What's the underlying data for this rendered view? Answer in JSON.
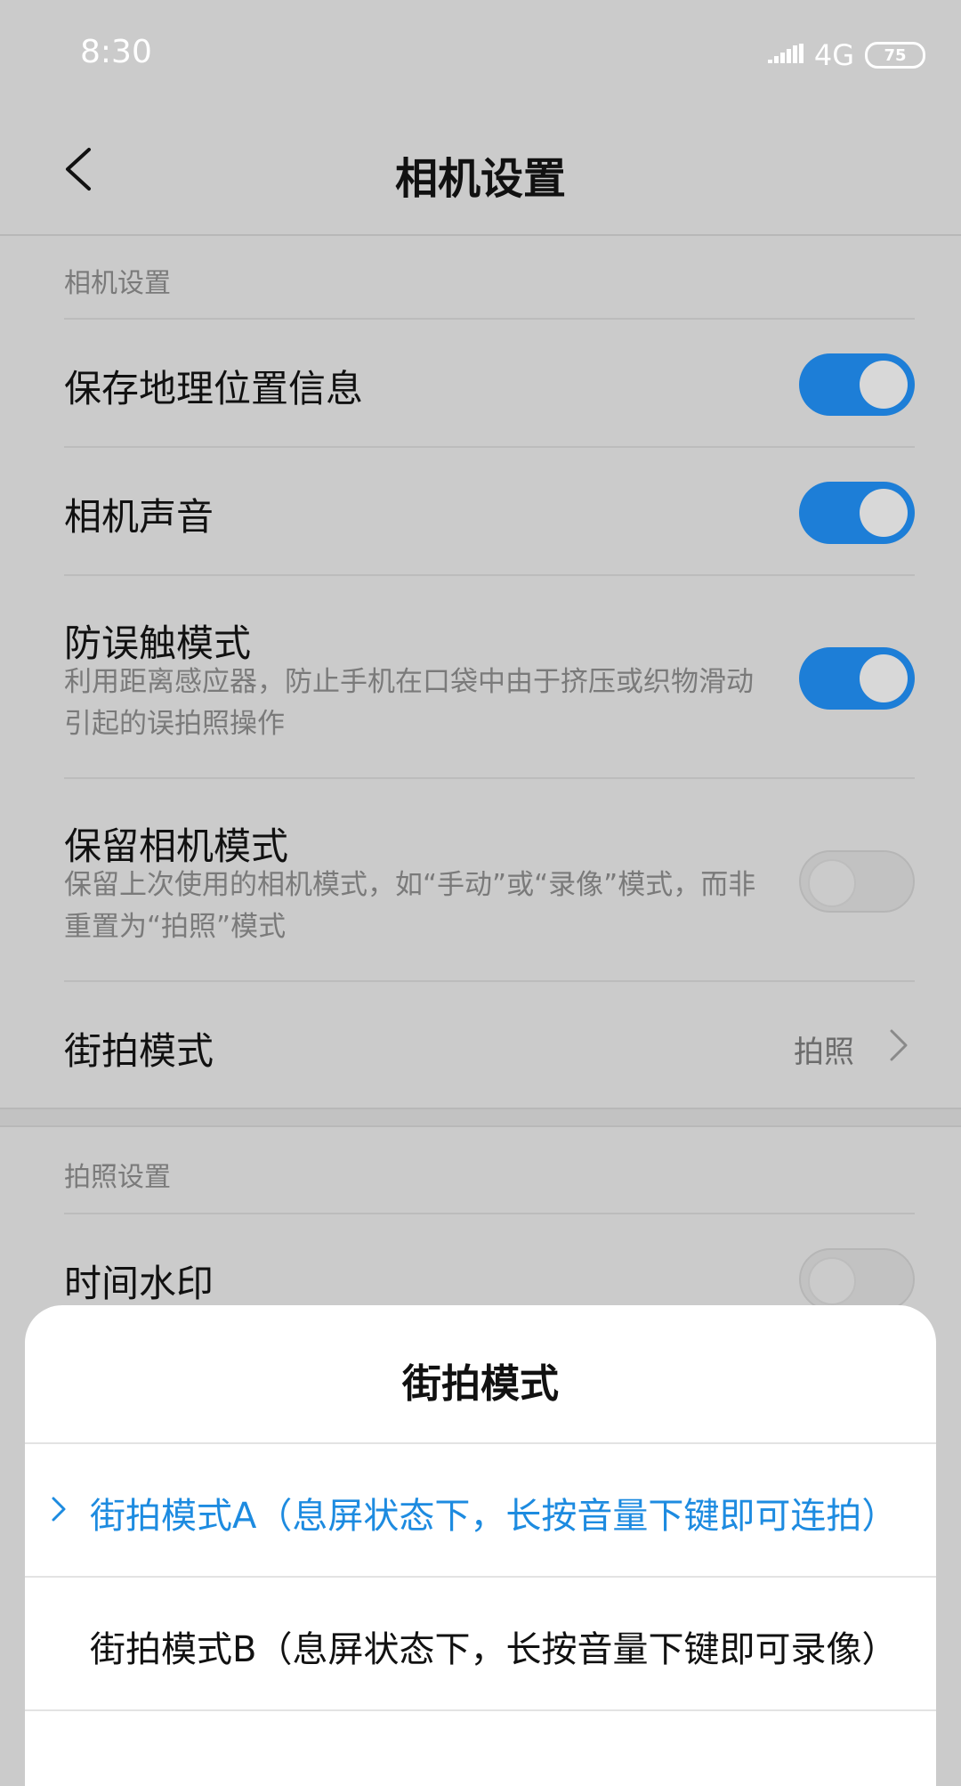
{
  "status_bar": {
    "time": "8:30",
    "network": "4G",
    "battery": "75"
  },
  "header": {
    "title": "相机设置",
    "back_icon": "back-arrow-icon"
  },
  "sections": {
    "camera_settings": {
      "label": "相机设置",
      "items": [
        {
          "title": "保存地理位置信息",
          "toggle": "on"
        },
        {
          "title": "相机声音",
          "toggle": "on"
        },
        {
          "title": "防误触模式",
          "desc": "利用距离感应器，防止手机在口袋中由于挤压或织物滑动引起的误拍照操作",
          "toggle": "on"
        },
        {
          "title": "保留相机模式",
          "desc": "保留上次使用的相机模式，如“手动”或“录像”模式，而非重置为“拍照”模式",
          "toggle": "off"
        },
        {
          "title": "街拍模式",
          "value": "拍照"
        }
      ]
    },
    "photo_settings": {
      "label": "拍照设置",
      "items": [
        {
          "title": "时间水印",
          "toggle": "off"
        }
      ]
    }
  },
  "bottom_sheet": {
    "title": "街拍模式",
    "options": [
      {
        "label": "街拍模式A（息屏状态下，长按音量下键即可连拍）",
        "selected": true
      },
      {
        "label": "街拍模式B（息屏状态下，长按音量下键即可录像）",
        "selected": false
      }
    ]
  },
  "colors": {
    "accent": "#1d7ed7",
    "selected_text": "#1d8be0",
    "overlay_background": "#cbcbcb"
  }
}
